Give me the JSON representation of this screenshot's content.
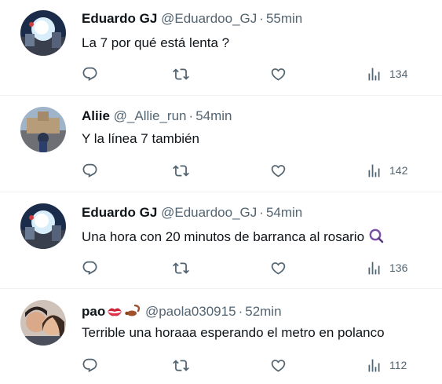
{
  "tweets": [
    {
      "name": "Eduardo GJ",
      "handle": "@Eduardoo_GJ",
      "separator": "·",
      "time": "55min",
      "text": "La 7 por qué está lenta ?",
      "views": "134"
    },
    {
      "name": "Aliie",
      "handle": "@_Allie_run",
      "separator": "·",
      "time": "54min",
      "text": "Y la línea 7 también",
      "views": "142"
    },
    {
      "name": "Eduardo GJ",
      "handle": "@Eduardoo_GJ",
      "separator": "·",
      "time": "54min",
      "text": "Una hora con 20 minutos de barranca al rosario",
      "text_emoji": "magnifying-glass-emoji",
      "views": "136"
    },
    {
      "name": "pao",
      "name_emojis": [
        "kiss-mark-emoji",
        "scorpion-emoji"
      ],
      "handle": "@paola030915",
      "separator": "·",
      "time": "52min",
      "text": "Terrible una horaaa esperando el metro en polanco",
      "views": "112"
    }
  ],
  "icons": {
    "reply": "reply-icon",
    "retweet": "retweet-icon",
    "like": "like-icon",
    "views": "views-icon"
  },
  "colors": {
    "text": "#0f1419",
    "secondary": "#536471",
    "divider": "#eff3f4"
  }
}
